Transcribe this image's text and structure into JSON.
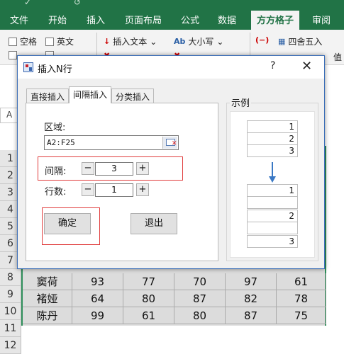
{
  "excel": {
    "tabs": [
      "文件",
      "开始",
      "插入",
      "页面布局",
      "公式",
      "数据",
      "方方格子",
      "审阅"
    ],
    "active_tab": "方方格子",
    "ribbon": {
      "space": "空格",
      "english": "英文",
      "insert_text": "插入文本",
      "case": "大小写",
      "round": "四舍五入",
      "value_partial": "值"
    },
    "name_box": "A",
    "row_numbers": [
      "1",
      "2",
      "3",
      "4",
      "5",
      "6",
      "7",
      "8",
      "9",
      "10",
      "11",
      "12"
    ],
    "rows": [
      {
        "name": "窦荷",
        "values": [
          "93",
          "77",
          "70",
          "97",
          "61"
        ]
      },
      {
        "name": "褚娅",
        "values": [
          "64",
          "80",
          "87",
          "82",
          "78"
        ]
      },
      {
        "name": "陈丹",
        "values": [
          "99",
          "61",
          "80",
          "87",
          "75"
        ]
      }
    ]
  },
  "dialog": {
    "title": "插入N行",
    "help": "?",
    "close": "✕",
    "tabs": [
      "直接插入",
      "间隔插入",
      "分类插入"
    ],
    "selected_tab": "间隔插入",
    "region_label": "区域:",
    "region_value": "A2:F25",
    "interval_label": "间隔:",
    "interval_value": "3",
    "rows_label": "行数:",
    "rows_value": "1",
    "minus": "−",
    "plus": "+",
    "ok_label": "确定",
    "exit_label": "退出",
    "example_title": "示例",
    "example_top": [
      "1",
      "2",
      "3"
    ],
    "example_bottom": [
      "1",
      "",
      "2",
      "",
      "3"
    ],
    "highlight_color": "#e03c3c",
    "arrow_color": "#3a78c4"
  }
}
